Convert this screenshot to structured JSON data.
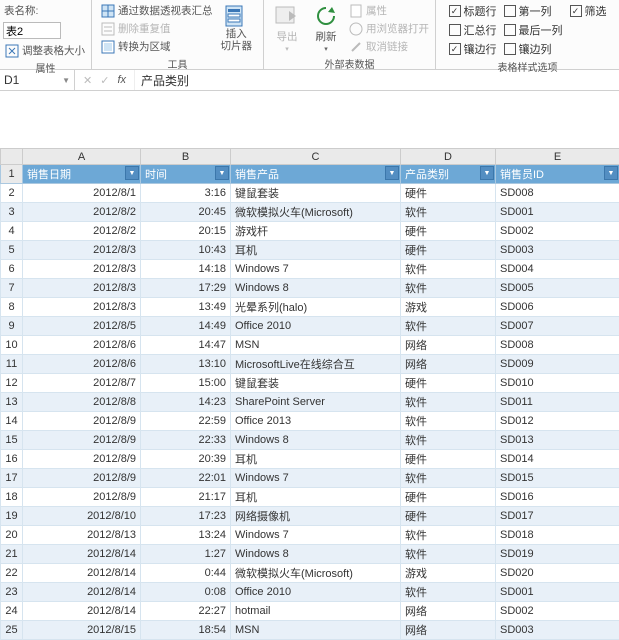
{
  "ribbon": {
    "props": {
      "name_label": "表名称:",
      "name_value": "表2",
      "resize": "调整表格大小",
      "group": "属性"
    },
    "tools": {
      "pivot": "通过数据透视表汇总",
      "dedup": "删除重复值",
      "convert": "转换为区域",
      "group": "工具",
      "slicer": "插入\n切片器"
    },
    "ext": {
      "export": "导出",
      "refresh": "刷新",
      "prop": "属性",
      "browser": "用浏览器打开",
      "unlink": "取消链接",
      "group": "外部表数据"
    },
    "style": {
      "header": "标题行",
      "total": "汇总行",
      "banded_row": "镶边行",
      "first": "第一列",
      "last": "最后一列",
      "banded_col": "镶边列",
      "filter": "筛选",
      "group": "表格样式选项"
    }
  },
  "namebox": "D1",
  "formula": "产品类别",
  "columns": [
    "A",
    "B",
    "C",
    "D",
    "E"
  ],
  "headers": [
    "销售日期",
    "时间",
    "销售产品",
    "产品类别",
    "销售员ID"
  ],
  "chart_data": {
    "type": "table",
    "columns": [
      "销售日期",
      "时间",
      "销售产品",
      "产品类别",
      "销售员ID"
    ],
    "rows": [
      [
        "2012/8/1",
        "3:16",
        "键鼠套装",
        "硬件",
        "SD008"
      ],
      [
        "2012/8/2",
        "20:45",
        "微软模拟火车(Microsoft)",
        "软件",
        "SD001"
      ],
      [
        "2012/8/2",
        "20:15",
        "游戏杆",
        "硬件",
        "SD002"
      ],
      [
        "2012/8/3",
        "10:43",
        "耳机",
        "硬件",
        "SD003"
      ],
      [
        "2012/8/3",
        "14:18",
        "Windows 7",
        "软件",
        "SD004"
      ],
      [
        "2012/8/3",
        "17:29",
        "Windows 8",
        "软件",
        "SD005"
      ],
      [
        "2012/8/3",
        "13:49",
        "光晕系列(halo)",
        "游戏",
        "SD006"
      ],
      [
        "2012/8/5",
        "14:49",
        "Office 2010",
        "软件",
        "SD007"
      ],
      [
        "2012/8/6",
        "14:47",
        "MSN",
        "网络",
        "SD008"
      ],
      [
        "2012/8/6",
        "13:10",
        "MicrosoftLive在线综合互",
        "网络",
        "SD009"
      ],
      [
        "2012/8/7",
        "15:00",
        "键鼠套装",
        "硬件",
        "SD010"
      ],
      [
        "2012/8/8",
        "14:23",
        "SharePoint Server",
        "软件",
        "SD011"
      ],
      [
        "2012/8/9",
        "22:59",
        "Office 2013",
        "软件",
        "SD012"
      ],
      [
        "2012/8/9",
        "22:33",
        "Windows 8",
        "软件",
        "SD013"
      ],
      [
        "2012/8/9",
        "20:39",
        "耳机",
        "硬件",
        "SD014"
      ],
      [
        "2012/8/9",
        "22:01",
        "Windows 7",
        "软件",
        "SD015"
      ],
      [
        "2012/8/9",
        "21:17",
        "耳机",
        "硬件",
        "SD016"
      ],
      [
        "2012/8/10",
        "17:23",
        "网络摄像机",
        "硬件",
        "SD017"
      ],
      [
        "2012/8/13",
        "13:24",
        "Windows 7",
        "软件",
        "SD018"
      ],
      [
        "2012/8/14",
        "1:27",
        "Windows 8",
        "软件",
        "SD019"
      ],
      [
        "2012/8/14",
        "0:44",
        "微软模拟火车(Microsoft)",
        "游戏",
        "SD020"
      ],
      [
        "2012/8/14",
        "0:08",
        "Office 2010",
        "软件",
        "SD001"
      ],
      [
        "2012/8/14",
        "22:27",
        "hotmail",
        "网络",
        "SD002"
      ],
      [
        "2012/8/15",
        "18:54",
        "MSN",
        "网络",
        "SD003"
      ]
    ]
  }
}
